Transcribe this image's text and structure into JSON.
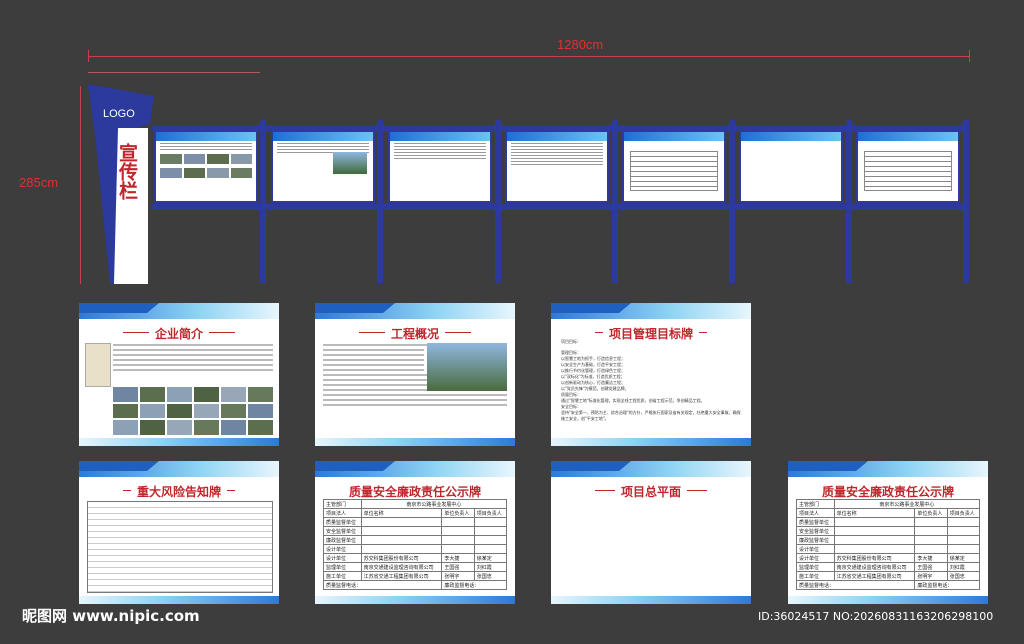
{
  "dimensions": {
    "width": "1280cm",
    "height": "285cm"
  },
  "sign": {
    "logo": "LOGO",
    "title": "宣传栏"
  },
  "panels": {
    "enterprise": {
      "title": "企业简介"
    },
    "project": {
      "title": "工程概况"
    },
    "goals": {
      "title": "项目管理目标牌",
      "lines": [
        "项目目标：",
        "管理目标：",
        "以智慧工地为抓手，打造信息工程；",
        "以安全生产为基础，打造平安工程；",
        "以推行节约化管理，打造绿色工程；",
        "以\"双标化\"为标准，打造优质工程；",
        "以创新驱动为核心，打造廉洁工程；",
        "以\"党员先锋\"为模范，创建党建品牌。",
        "质量目标：",
        "通过\"智慧工地\"标准化管理，实现全线工程优质，创省工程示范，争创精品工程。",
        "安全目标：",
        "坚持\"安全第一、预防为主、综合治理\"的方针，严格执行国家及省有关规定，杜绝重大安全事故，确保施工安全，创\"平安工地\"。"
      ]
    },
    "risk": {
      "title": "重大风险告知牌"
    },
    "quality_left": {
      "title": "质量安全廉政责任公示牌",
      "rows": [
        [
          "主管部门",
          "南京市公路事业发展中心"
        ],
        [
          "项目法人",
          "单位名称",
          "单位负责人",
          "项目负责人"
        ],
        [
          "质量监督单位",
          "",
          "",
          ""
        ],
        [
          "安全监督单位",
          "",
          "",
          ""
        ],
        [
          "廉政监督单位",
          "",
          "",
          ""
        ],
        [
          "设计单位",
          "",
          "",
          ""
        ],
        [
          "设计单位",
          "苏交科集团股份有限公司",
          "李大捷",
          "徐某定"
        ],
        [
          "监理单位",
          "南京交通建设监理咨询有限公司",
          "王国强",
          "刘红霞"
        ],
        [
          "施工单位",
          "江苏省交通工程集团有限公司",
          "张明宇",
          "张国忠"
        ],
        [
          "质量监督电话：",
          "",
          "廉政监督电话：",
          ""
        ]
      ]
    },
    "plan": {
      "title": "项目总平面"
    },
    "quality_right": {
      "title": "质量安全廉政责任公示牌",
      "rows": [
        [
          "主管部门",
          "南京市公路事业发展中心"
        ],
        [
          "项目法人",
          "单位名称",
          "单位负责人",
          "项目负责人"
        ],
        [
          "质量监督单位",
          "",
          "",
          ""
        ],
        [
          "安全监督单位",
          "",
          "",
          ""
        ],
        [
          "廉政监督单位",
          "",
          "",
          ""
        ],
        [
          "设计单位",
          "",
          "",
          ""
        ],
        [
          "设计单位",
          "苏交科集团股份有限公司",
          "李大捷",
          "徐某定"
        ],
        [
          "监理单位",
          "南京交通建设监理咨询有限公司",
          "王国强",
          "刘红霞"
        ],
        [
          "施工单位",
          "江苏省交通工程集团有限公司",
          "张明宇",
          "张国忠"
        ],
        [
          "质量监督电话：",
          "",
          "廉政监督电话：",
          ""
        ]
      ]
    }
  },
  "watermark": {
    "site": "昵图网 www.nipic.com",
    "id": "ID:36024517 NO:20260831163206298100"
  }
}
